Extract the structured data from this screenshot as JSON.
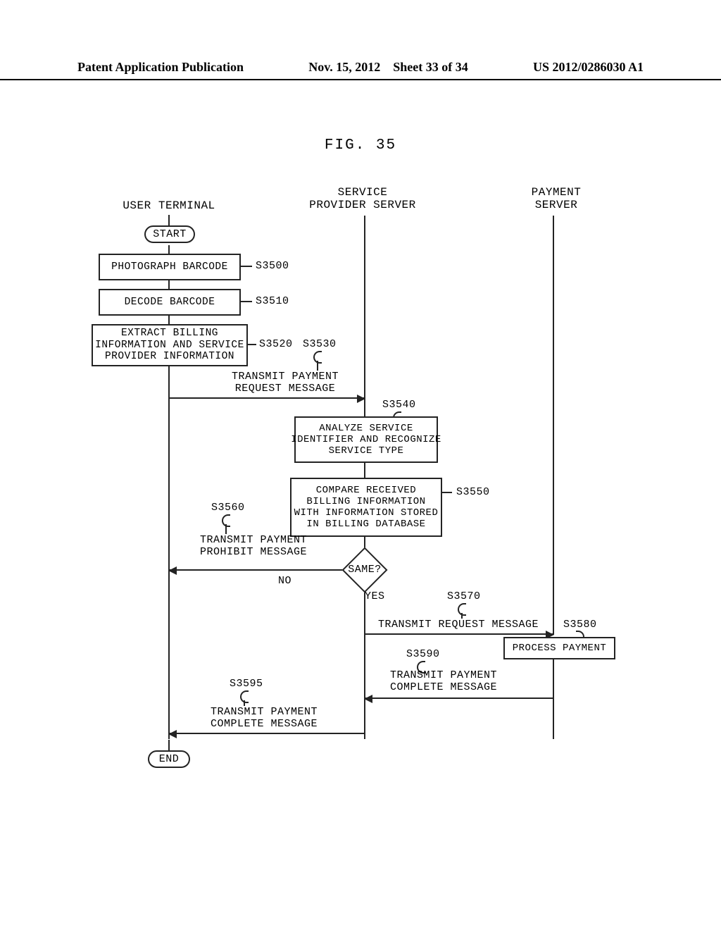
{
  "header": {
    "pub": "Patent Application Publication",
    "date": "Nov. 15, 2012",
    "sheet": "Sheet 33 of 34",
    "docnum": "US 2012/0286030 A1"
  },
  "figure_title": "FIG. 35",
  "columns": {
    "user_terminal": "USER TERMINAL",
    "service_provider": "SERVICE\nPROVIDER SERVER",
    "payment_server": "PAYMENT\nSERVER"
  },
  "terminators": {
    "start": "START",
    "end": "END"
  },
  "steps": {
    "s3500": {
      "ref": "S3500",
      "text": "PHOTOGRAPH BARCODE"
    },
    "s3510": {
      "ref": "S3510",
      "text": "DECODE BARCODE"
    },
    "s3520": {
      "ref": "S3520",
      "text": "EXTRACT BILLING\nINFORMATION AND SERVICE\nPROVIDER INFORMATION"
    },
    "s3530": {
      "ref": "S3530",
      "msg": "TRANSMIT PAYMENT\nREQUEST MESSAGE"
    },
    "s3540": {
      "ref": "S3540",
      "text": "ANALYZE SERVICE\nIDENTIFIER AND RECOGNIZE\nSERVICE TYPE"
    },
    "s3550": {
      "ref": "S3550",
      "text": "COMPARE RECEIVED\nBILLING INFORMATION\nWITH INFORMATION STORED\nIN BILLING DATABASE"
    },
    "s3560": {
      "ref": "S3560",
      "msg": "TRANSMIT PAYMENT\nPROHIBIT MESSAGE"
    },
    "s3570": {
      "ref": "S3570",
      "msg": "TRANSMIT REQUEST MESSAGE"
    },
    "s3580": {
      "ref": "S3580",
      "text": "PROCESS PAYMENT"
    },
    "s3590": {
      "ref": "S3590",
      "msg": "TRANSMIT PAYMENT\nCOMPLETE MESSAGE"
    },
    "s3595": {
      "ref": "S3595",
      "msg": "TRANSMIT PAYMENT\nCOMPLETE MESSAGE"
    }
  },
  "decision": {
    "label": "SAME?",
    "no": "NO",
    "yes": "YES"
  }
}
